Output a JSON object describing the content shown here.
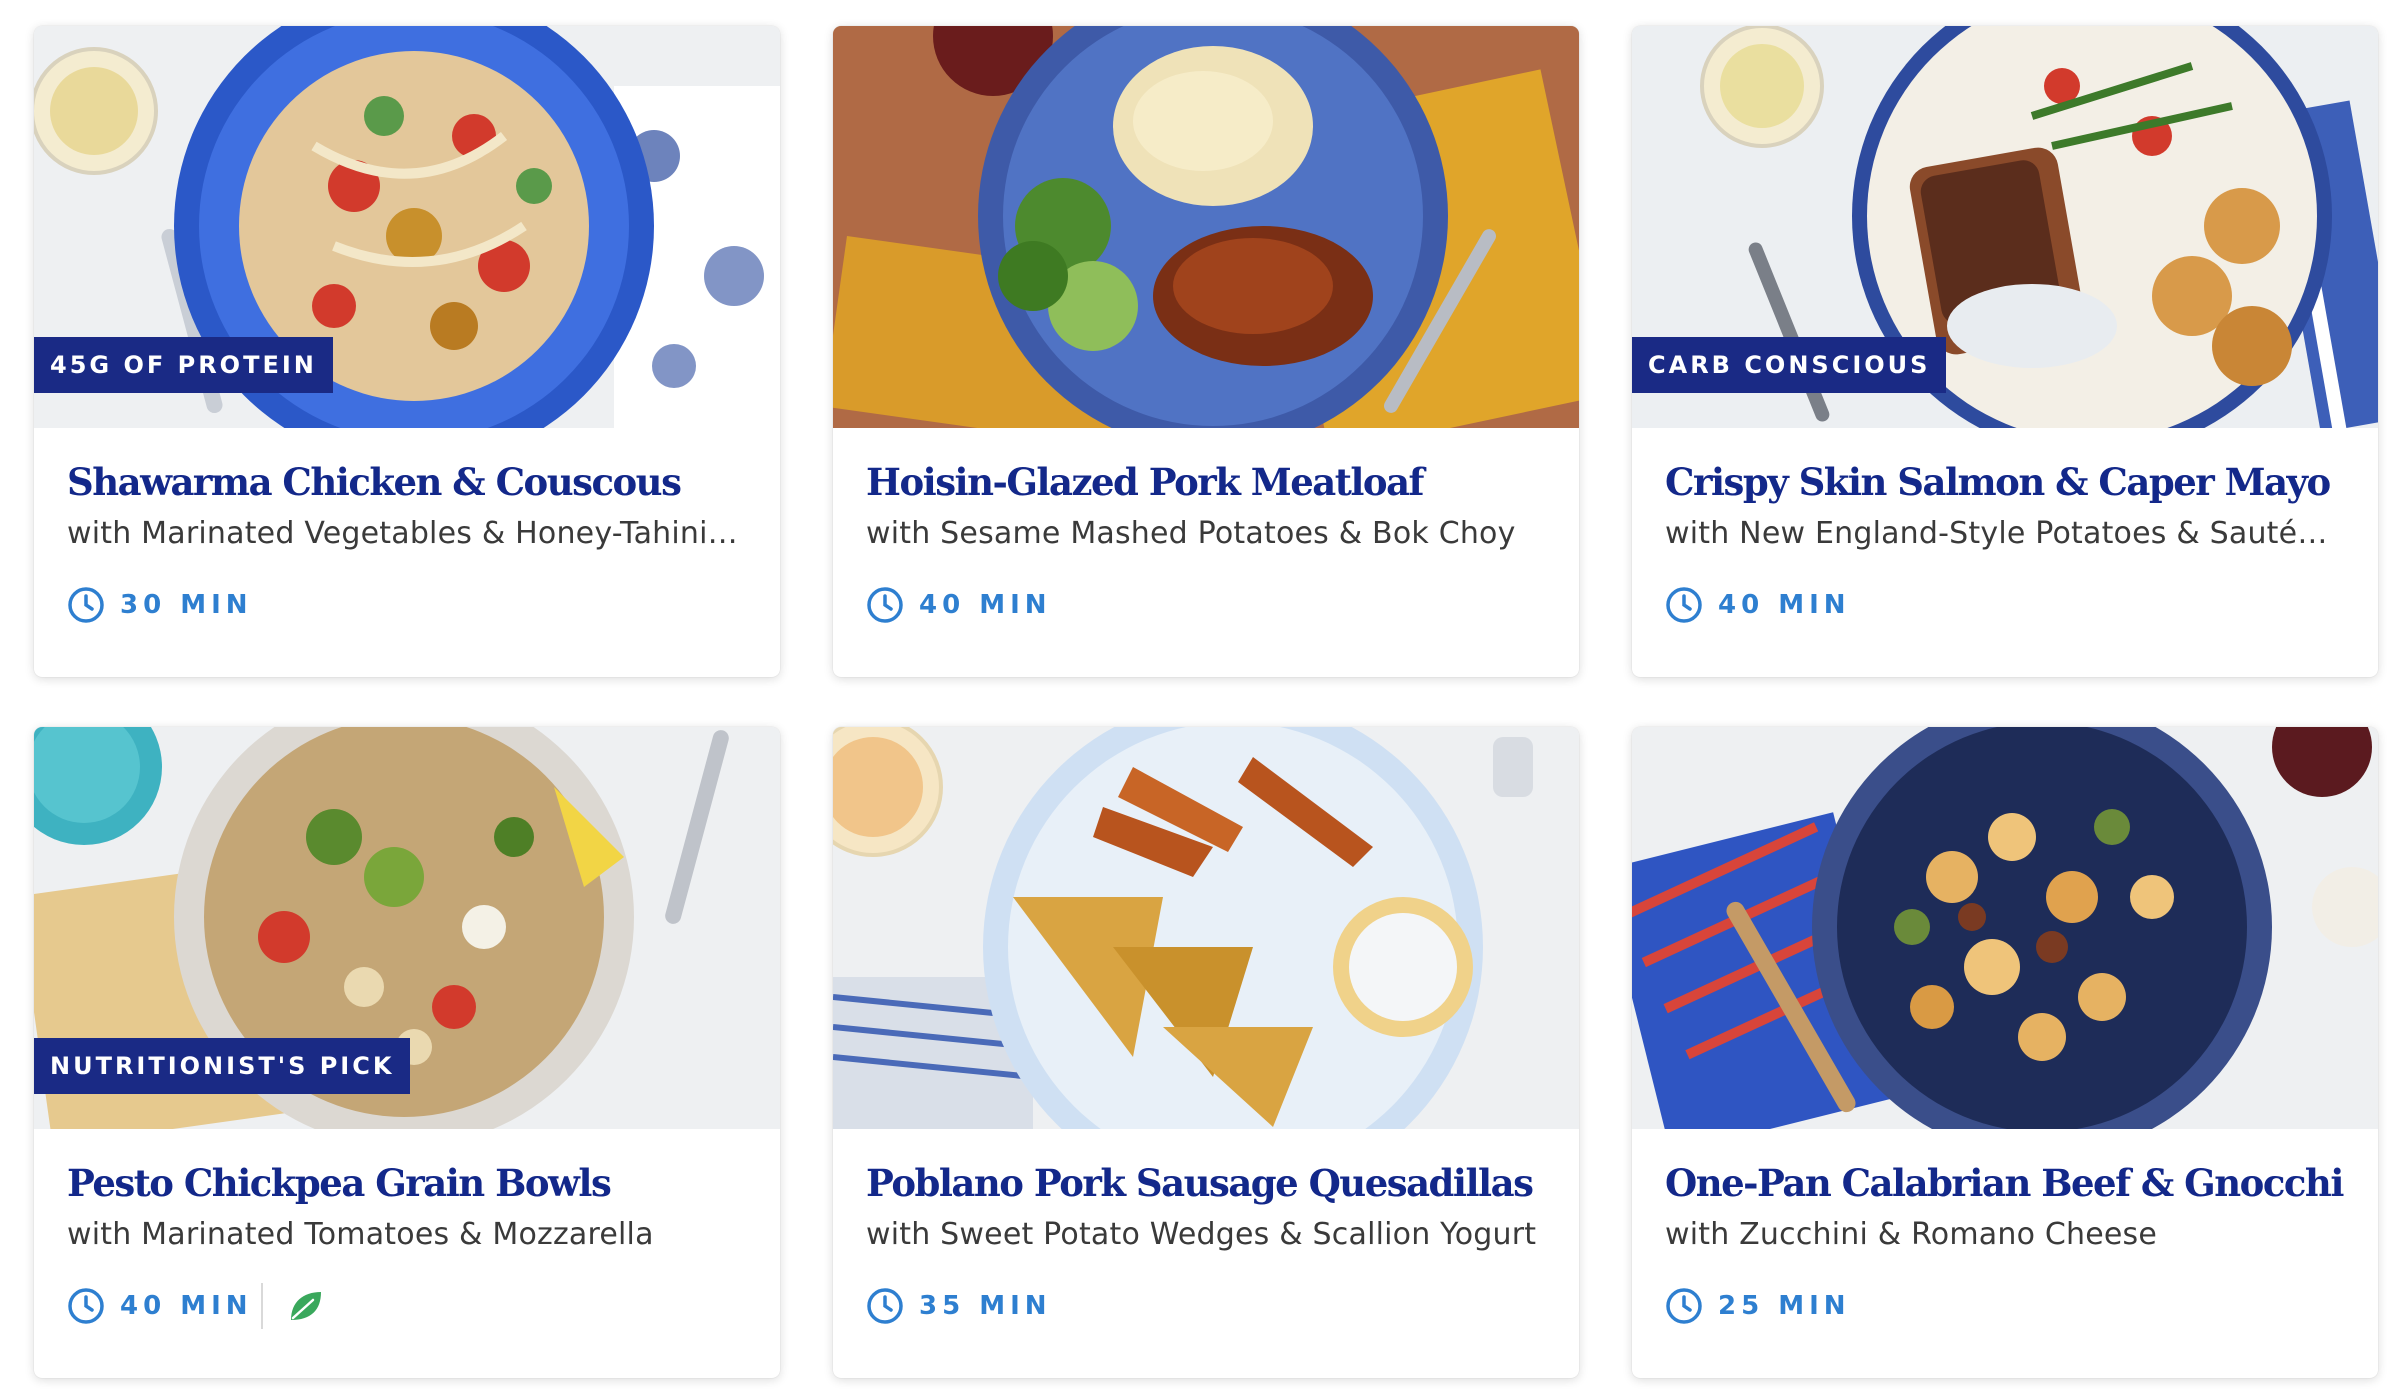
{
  "recipes": [
    {
      "tag": "45G OF PROTEIN",
      "title": "Shawarma Chicken & Couscous",
      "subtitle": "with Marinated Vegetables & Honey-Tahini Sa...",
      "time": "30 MIN"
    },
    {
      "tag": "",
      "title": "Hoisin-Glazed Pork Meatloaf",
      "subtitle": "with Sesame Mashed Potatoes & Bok Choy",
      "time": "40 MIN"
    },
    {
      "tag": "CARB CONSCIOUS",
      "title": "Crispy Skin Salmon & Caper Mayo",
      "subtitle": "with New England-Style Potatoes & Sautéed ...",
      "time": "40 MIN"
    },
    {
      "tag": "NUTRITIONIST'S PICK",
      "title": "Pesto Chickpea Grain Bowls",
      "subtitle": "with Marinated Tomatoes & Mozzarella",
      "time": "40 MIN",
      "icons": [
        "vegetarian-leaf-icon"
      ]
    },
    {
      "tag": "",
      "title": "Poblano Pork Sausage Quesadillas",
      "subtitle": "with Sweet Potato Wedges & Scallion Yogurt",
      "time": "35 MIN"
    },
    {
      "tag": "",
      "title": "One-Pan Calabrian Beef & Gnocchi",
      "subtitle": "with Zucchini & Romano Cheese",
      "time": "25 MIN"
    }
  ],
  "colors": {
    "title": "#13288a",
    "tag_bg": "#1a2a85",
    "time": "#2e7fd0",
    "leaf": "#3aa85c",
    "subtitle": "#3a3a3a"
  },
  "icons": {
    "clock": "clock-icon",
    "leaf": "vegetarian-leaf-icon"
  }
}
